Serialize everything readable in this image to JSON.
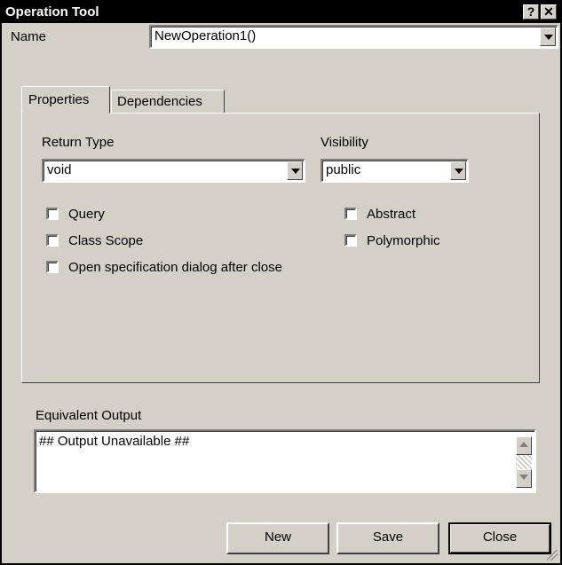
{
  "window": {
    "title": "Operation Tool",
    "help_symbol": "?",
    "close_symbol": "✕"
  },
  "name_row": {
    "label": "Name",
    "value": "NewOperation1()"
  },
  "tabs": [
    {
      "label": "Properties"
    },
    {
      "label": "Dependencies"
    }
  ],
  "properties": {
    "return_type_label": "Return Type",
    "return_type_value": "void",
    "visibility_label": "Visibility",
    "visibility_value": "public",
    "checkboxes": [
      {
        "label": "Query",
        "checked": false
      },
      {
        "label": "Class Scope",
        "checked": false
      },
      {
        "label": "Open specification dialog after close",
        "checked": false
      },
      {
        "label": "Abstract",
        "checked": false
      },
      {
        "label": "Polymorphic",
        "checked": false
      }
    ]
  },
  "output": {
    "label": "Equivalent Output",
    "text": "## Output Unavailable ##"
  },
  "buttons": {
    "new": "New",
    "save": "Save",
    "close": "Close"
  }
}
